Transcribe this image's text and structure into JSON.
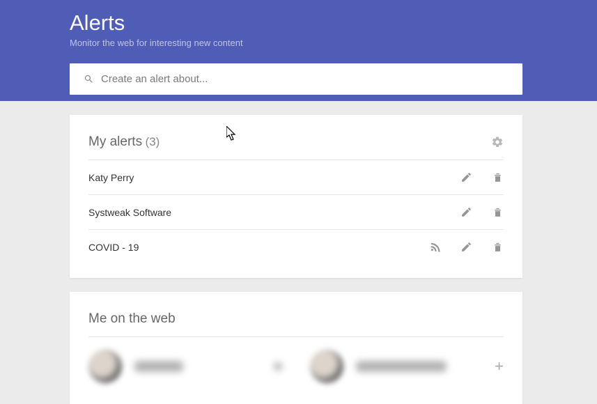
{
  "header": {
    "title": "Alerts",
    "subtitle": "Monitor the web for interesting new content",
    "search": {
      "placeholder": "Create an alert about..."
    }
  },
  "my_alerts": {
    "title": "My alerts",
    "count_label": "(3)",
    "items": [
      {
        "name": "Katy Perry",
        "has_rss": false
      },
      {
        "name": "Systweak Software",
        "has_rss": false
      },
      {
        "name": "COVID - 19",
        "has_rss": true
      }
    ]
  },
  "me_on_web": {
    "title": "Me on the web"
  }
}
